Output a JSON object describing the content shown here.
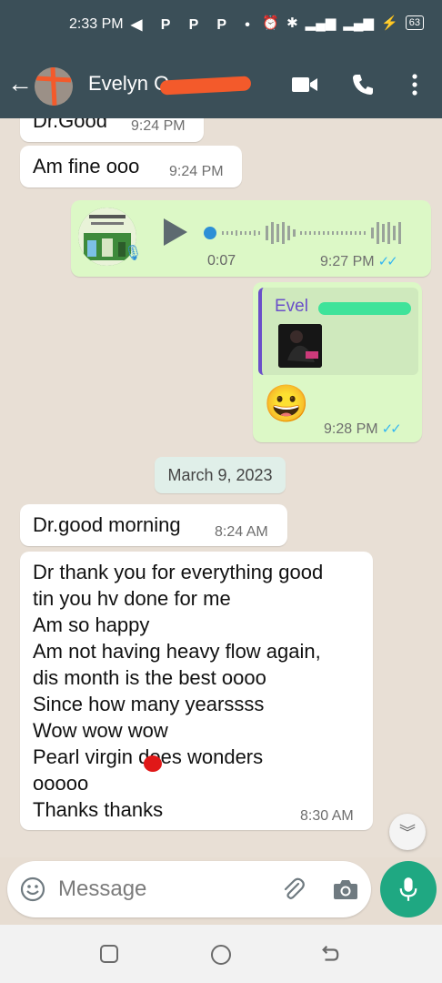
{
  "status_bar": {
    "time": "2:33 PM",
    "app_icons": "◀ P P P •",
    "battery": "63"
  },
  "header": {
    "back_icon": "arrow-left-icon",
    "contact_name": "Evelyn O.",
    "icons": [
      "video-call-icon",
      "phone-icon",
      "more-vert-icon"
    ]
  },
  "messages": [
    {
      "direction": "in",
      "text": "Dr.Good",
      "time": "9:24 PM"
    },
    {
      "direction": "in",
      "text": "Am fine ooo",
      "time": "9:24 PM"
    },
    {
      "direction": "out",
      "type": "voice",
      "duration": "0:07",
      "time": "9:27 PM",
      "ticks": "✓✓"
    },
    {
      "direction": "out",
      "type": "reply",
      "reply_name": "Evel",
      "emoji": "😀",
      "time": "9:28 PM",
      "ticks": "✓✓"
    },
    {
      "direction": "in",
      "text": "Dr.good morning",
      "time": "8:24 AM"
    },
    {
      "direction": "in",
      "lines": [
        "Dr thank you for everything good",
        "tin you hv done for me",
        "Am so happy",
        "Am not having heavy flow again,",
        "dis month is the best oooo",
        "Since how many yearssss",
        "Wow wow wow",
        "Pearl virgin does wonders",
        "ooooo",
        "Thanks thanks"
      ],
      "time": "8:30 AM"
    }
  ],
  "date_separator": "March 9, 2023",
  "composer": {
    "placeholder": "Message"
  },
  "colors": {
    "header": "#3b4f58",
    "outgoing_bubble": "#dcf8c6",
    "incoming_bubble": "#ffffff",
    "accent": "#1fa882",
    "read_ticks": "#34b7f1"
  }
}
